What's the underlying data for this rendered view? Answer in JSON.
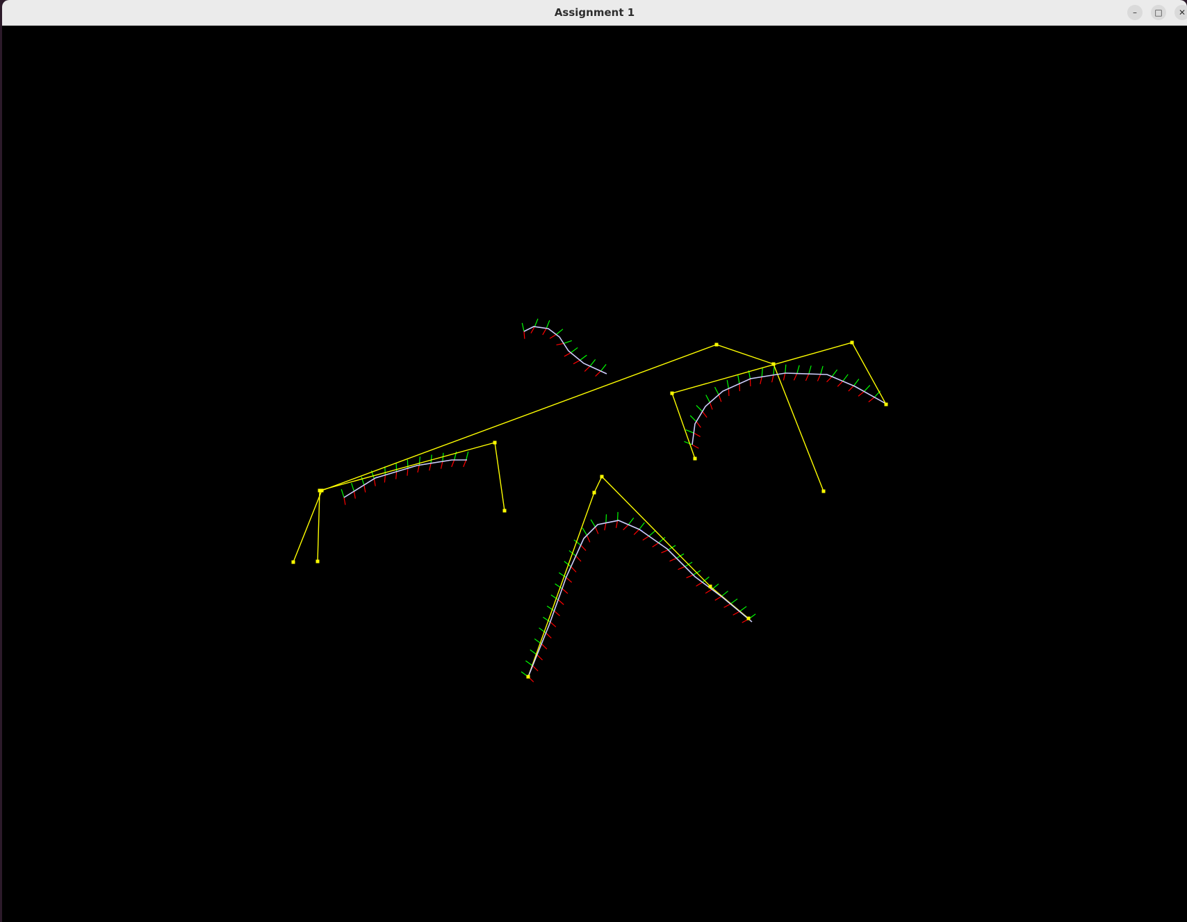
{
  "window": {
    "title": "Assignment 1",
    "buttons": [
      {
        "name": "minimize-button",
        "glyph": "–"
      },
      {
        "name": "maximize-button",
        "glyph": "□"
      },
      {
        "name": "close-button",
        "glyph": "✕"
      }
    ]
  },
  "colors": {
    "background": "#000000",
    "control_polygon": "#ffff00",
    "control_point": "#ffff00",
    "curve": "#d0d0ff",
    "tangent": "#00ff00",
    "normal": "#ff0000",
    "binormal": "#0000ff"
  }
}
